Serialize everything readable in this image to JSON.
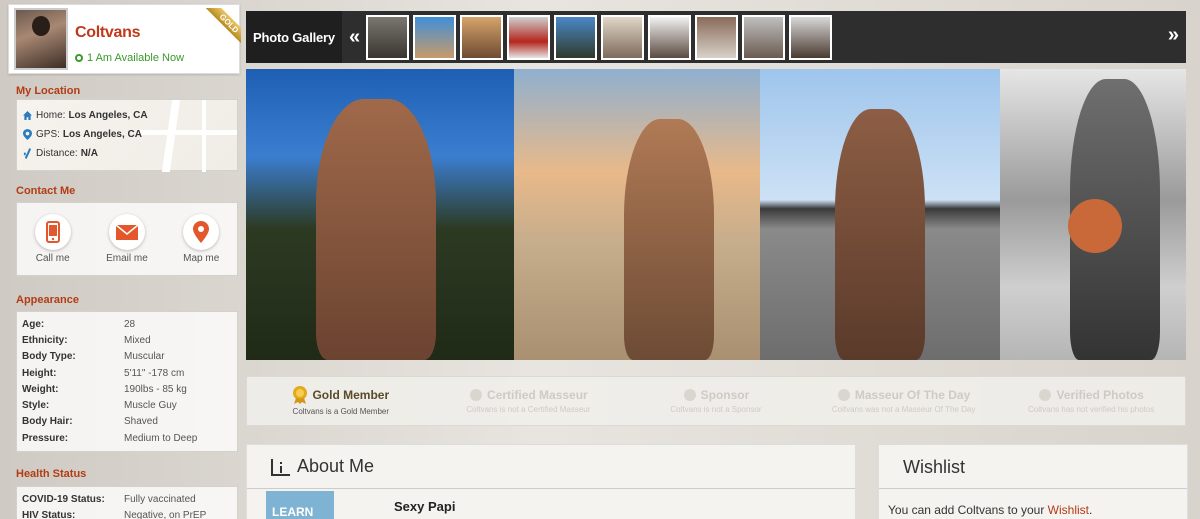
{
  "profile": {
    "name": "Coltvans",
    "availability": "1 Am Available Now",
    "ribbon": "GOLD"
  },
  "location": {
    "title": "My Location",
    "home_label": "Home:",
    "home_value": "Los Angeles, CA",
    "gps_label": "GPS:",
    "gps_value": "Los Angeles, CA",
    "distance_label": "Distance:",
    "distance_value": "N/A"
  },
  "contact": {
    "title": "Contact Me",
    "call": "Call me",
    "email": "Email me",
    "map": "Map me"
  },
  "appearance": {
    "title": "Appearance",
    "rows": [
      {
        "k": "Age:",
        "v": "28"
      },
      {
        "k": "Ethnicity:",
        "v": "Mixed"
      },
      {
        "k": "Body Type:",
        "v": "Muscular"
      },
      {
        "k": "Height:",
        "v": "5'11\" -178 cm"
      },
      {
        "k": "Weight:",
        "v": "190lbs - 85 kg"
      },
      {
        "k": "Style:",
        "v": "Muscle Guy"
      },
      {
        "k": "Body Hair:",
        "v": "Shaved"
      },
      {
        "k": "Pressure:",
        "v": "Medium to Deep"
      }
    ]
  },
  "health": {
    "title": "Health Status",
    "rows": [
      {
        "k": "COVID-19 Status:",
        "v": "Fully vaccinated"
      },
      {
        "k": "HIV Status:",
        "v": "Negative, on PrEP"
      }
    ]
  },
  "gallery": {
    "label": "Photo Gallery",
    "prev": "«",
    "next": "»"
  },
  "badges": [
    {
      "title": "Gold Member",
      "sub": "Coltvans is a Gold Member"
    },
    {
      "title": "Certified Masseur",
      "sub": "Coltvans is not a Certified Masseur"
    },
    {
      "title": "Sponsor",
      "sub": "Coltvans is not a Sponsor"
    },
    {
      "title": "Masseur Of The Day",
      "sub": "Coltvans was not a Masseur Of The Day"
    },
    {
      "title": "Verified Photos",
      "sub": "Coltvans has not verified his photos"
    }
  ],
  "about": {
    "title": "About Me",
    "learn_more": "LEARN MORE",
    "subtitle": "Sexy Papi"
  },
  "wishlist": {
    "title": "Wishlist",
    "text_before": "You can add Coltvans to your ",
    "link": "Wishlist",
    "text_after": "."
  },
  "colors": {
    "accent": "#b23c14",
    "available": "#3a9a2a",
    "gallery_bar": "#2e2e2e"
  }
}
